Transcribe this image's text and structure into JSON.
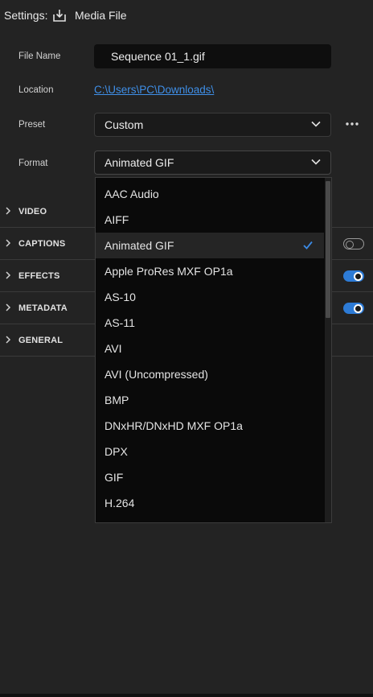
{
  "header": {
    "settings_label": "Settings:",
    "icon": "download-icon",
    "title": "Media File"
  },
  "fields": {
    "file_name": {
      "label": "File Name",
      "value": "Sequence 01_1.gif"
    },
    "location": {
      "label": "Location",
      "value": "C:\\Users\\PC\\Downloads\\"
    },
    "preset": {
      "label": "Preset",
      "value": "Custom"
    },
    "format": {
      "label": "Format",
      "value": "Animated GIF"
    }
  },
  "sections": [
    {
      "label": "VIDEO"
    },
    {
      "label": "CAPTIONS",
      "toggle": "off"
    },
    {
      "label": "EFFECTS",
      "toggle": "on"
    },
    {
      "label": "METADATA",
      "toggle": "on"
    },
    {
      "label": "GENERAL"
    }
  ],
  "format_options": [
    "AAC Audio",
    "AIFF",
    "Animated GIF",
    "Apple ProRes MXF OP1a",
    "AS-10",
    "AS-11",
    "AVI",
    "AVI (Uncompressed)",
    "BMP",
    "DNxHR/DNxHD MXF OP1a",
    "DPX",
    "GIF",
    "H.264"
  ],
  "selected_format": "Animated GIF",
  "colors": {
    "accent": "#2d7bd6",
    "link": "#3f8fe8",
    "background": "#232323"
  }
}
